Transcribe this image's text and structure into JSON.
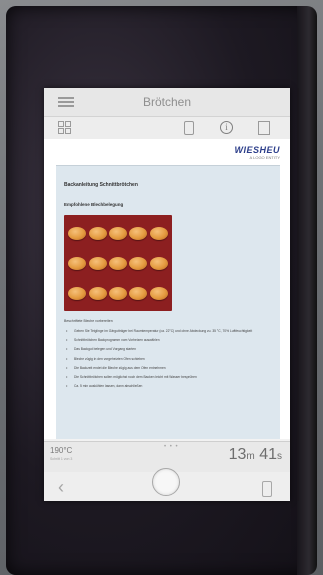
{
  "header": {
    "title": "Brötchen"
  },
  "document": {
    "logo_text": "WIESHEU",
    "logo_sub": "A LOGO ENTITY",
    "heading": "Backanleitung Schnittbrötchen",
    "subheading": "Empfohlene Blechbelegung",
    "roll_count": 15,
    "step_intro": "Beschriftete Bleche vorbereiten",
    "steps": [
      "Geben Sie Teiglinge im Gärgutträger bei Raumtemperatur (ca. 22°C) und ohne Abdeckung zu. 35 °C, 70% Luftfeuchtigkeit",
      "Schnittbrötchen Backprogramm vom Vorheizen auswählen",
      "Das Backgut belegen und Vorgang starten",
      "Bleche zügig in den vorgeheizten Ofen schieben",
      "Die Backzeit endet die Bleche zügig aus dem Ofen entnehmen",
      "Die Schnittbrötchen sollen möglichst noch dem Backen leicht mit Wasser besprühen",
      "Ca. 5 min auskühlen lassen, dann abschließen"
    ]
  },
  "status": {
    "temperature": "190°C",
    "temperature_sub": "Schritt 1 von 3",
    "dots": "• • •",
    "timer_minutes": "13",
    "timer_min_unit": "m",
    "timer_seconds": "41",
    "timer_sec_unit": "s"
  },
  "nav": {
    "back_glyph": "‹"
  }
}
